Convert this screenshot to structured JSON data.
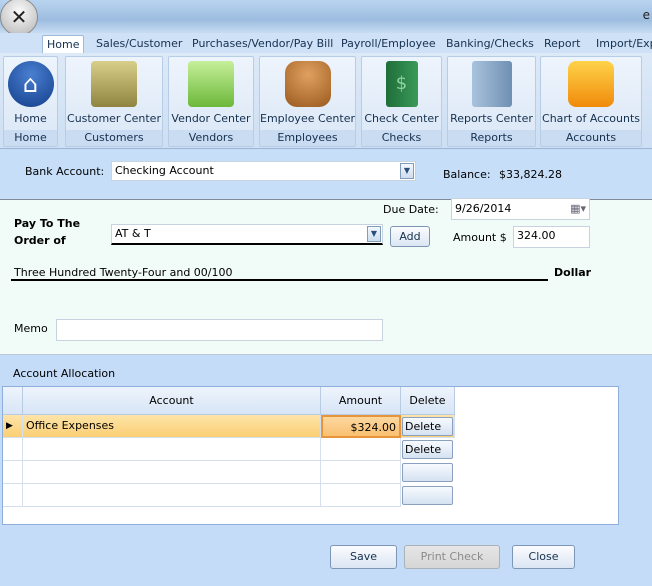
{
  "window": {
    "title_fragment": "e"
  },
  "tabs": [
    {
      "label": "Home",
      "active": true
    },
    {
      "label": "Sales/Customer"
    },
    {
      "label": "Purchases/Vendor/Pay Bill"
    },
    {
      "label": "Payroll/Employee"
    },
    {
      "label": "Banking/Checks"
    },
    {
      "label": "Report"
    },
    {
      "label": "Import/Exp"
    }
  ],
  "ribbon": [
    {
      "button": "Home",
      "group": "Home",
      "icon": "home-icon",
      "color": "#1d4fa0"
    },
    {
      "button": "Customer Center",
      "group": "Customers",
      "icon": "customer-folder-icon",
      "color": "#9a8a4a"
    },
    {
      "button": "Vendor Center",
      "group": "Vendors",
      "icon": "vendor-book-icon",
      "color": "#7bc64a"
    },
    {
      "button": "Employee Center",
      "group": "Employees",
      "icon": "employees-icon",
      "color": "#b8702a"
    },
    {
      "button": "Check Center",
      "group": "Checks",
      "icon": "checkbook-icon",
      "color": "#2e8a4a"
    },
    {
      "button": "Reports Center",
      "group": "Reports",
      "icon": "reports-binder-icon",
      "color": "#8aa8c8"
    },
    {
      "button": "Chart of Accounts",
      "group": "Accounts",
      "icon": "accounts-folder-icon",
      "color": "#f5a623"
    }
  ],
  "bank": {
    "label": "Bank Account:",
    "value": "Checking Account",
    "balance_label": "Balance:",
    "balance": "$33,824.28"
  },
  "check": {
    "due_date_label": "Due Date:",
    "due_date": "9/26/2014",
    "pay_to_label_1": "Pay To The",
    "pay_to_label_2": "Order of",
    "payee": "AT & T",
    "add_label": "Add",
    "amount_label": "Amount $",
    "amount": "324.00",
    "amount_words": "Three Hundred Twenty-Four and 00/100",
    "dollar_label": "Dollar",
    "memo_label": "Memo",
    "memo": ""
  },
  "allocation": {
    "title": "Account Allocation",
    "columns": [
      "Account",
      "Amount",
      "Delete"
    ],
    "rows": [
      {
        "account": "Office Expenses",
        "amount": "$324.00",
        "delete": "Delete",
        "selected": true
      },
      {
        "account": "",
        "amount": "",
        "delete": "Delete"
      },
      {
        "account": "",
        "amount": "",
        "delete": ""
      },
      {
        "account": "",
        "amount": "",
        "delete": ""
      }
    ]
  },
  "footer": {
    "save": "Save",
    "print": "Print Check",
    "close": "Close"
  }
}
